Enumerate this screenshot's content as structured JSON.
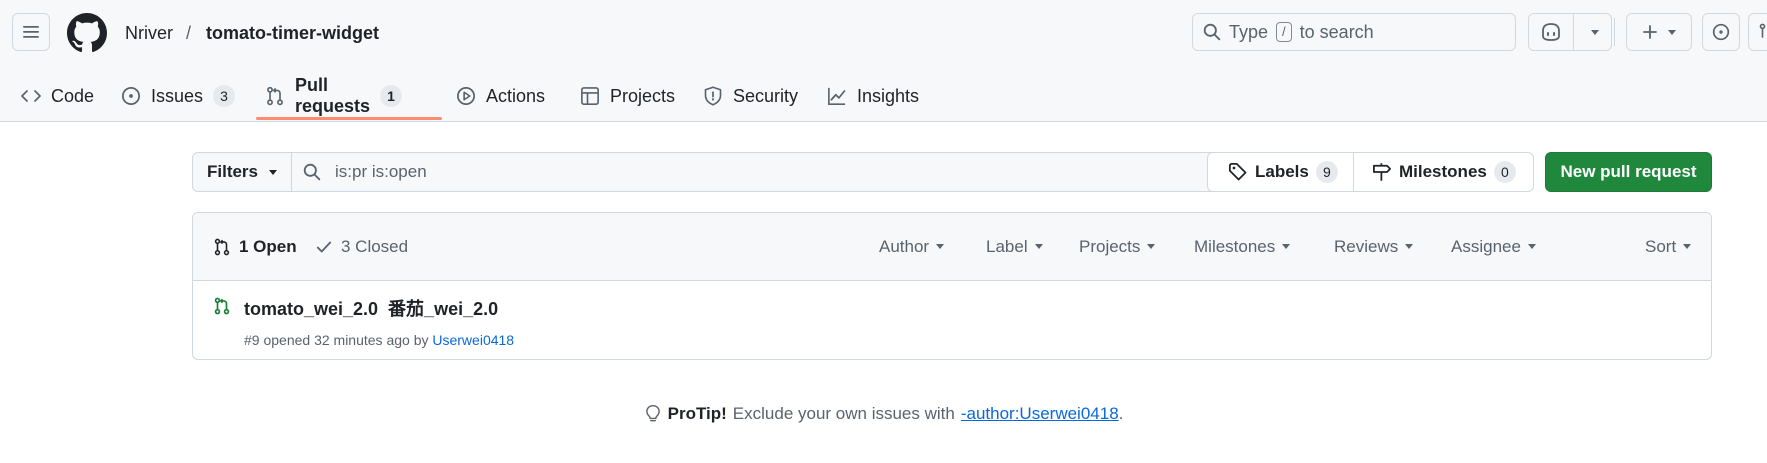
{
  "header": {
    "owner": "Nriver",
    "separator": "/",
    "repo": "tomato-timer-widget",
    "search": {
      "before": "Type",
      "key": "/",
      "after": "to search"
    }
  },
  "tabs": [
    {
      "label": "Code",
      "icon": "code-icon"
    },
    {
      "label": "Issues",
      "count": "3",
      "icon": "issue-opened-icon"
    },
    {
      "label": "Pull requests",
      "count": "1",
      "icon": "git-pull-request-icon",
      "selected": true
    },
    {
      "label": "Actions",
      "icon": "play-icon"
    },
    {
      "label": "Projects",
      "icon": "table-icon"
    },
    {
      "label": "Security",
      "icon": "shield-icon"
    },
    {
      "label": "Insights",
      "icon": "graph-icon"
    }
  ],
  "toolbar": {
    "filters_label": "Filters",
    "search_value": "is:pr is:open",
    "labels_label": "Labels",
    "labels_count": "9",
    "milestones_label": "Milestones",
    "milestones_count": "0",
    "new_pr_label": "New pull request"
  },
  "list": {
    "open_label": "1 Open",
    "closed_label": "3 Closed",
    "filters": [
      "Author",
      "Label",
      "Projects",
      "Milestones",
      "Reviews",
      "Assignee",
      "Sort"
    ],
    "items": [
      {
        "title": "tomato_wei_2.0  番茄_wei_2.0",
        "meta": "#9 opened 32 minutes ago by",
        "author": "Userwei0418"
      }
    ]
  },
  "protip": {
    "label": "ProTip!",
    "text": "Exclude your own issues with",
    "link": "-author:Userwei0418",
    "end": "."
  },
  "colors": {
    "accent_green": "#1f883d",
    "link_blue": "#0969da",
    "tab_underline": "#fd8c73",
    "open_green": "#1a7f37"
  }
}
